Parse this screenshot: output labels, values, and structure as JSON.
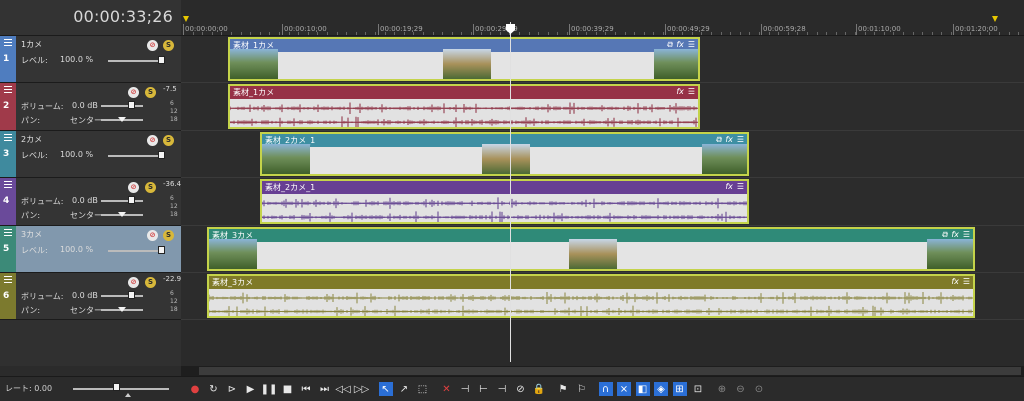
{
  "timecode": "00:00:33;26",
  "ruler": {
    "labels": [
      "00:00:00;00",
      "00:00:10;00",
      "00:00:19;29",
      "00:00:29;29",
      "00:00:39;29",
      "00:00:49;29",
      "00:00:59;28",
      "00:01:10;00",
      "00:01:20;00"
    ]
  },
  "tracks": [
    {
      "num": "1",
      "kind": "video",
      "name": "1カメ",
      "level_label": "レベル:",
      "level_value": "100.0 %",
      "level": 1.0,
      "color": "#4f7dbf",
      "event": {
        "name": "素材_1カメ",
        "bar_color": "#5677b5",
        "icons": [
          "crop",
          "fx",
          "menu"
        ]
      }
    },
    {
      "num": "2",
      "kind": "audio",
      "volume_label": "ボリューム:",
      "volume_value": "0.0 dB",
      "pan_label": "パン:",
      "pan_value": "センター",
      "peak": "-7.5",
      "scale": [
        "6",
        "12",
        "18"
      ],
      "color": "#a03a4a",
      "event": {
        "name": "素材_1カメ",
        "bar_color": "#963146",
        "icons": [
          "fx",
          "menu"
        ],
        "wave_color": "#8a2a3e"
      }
    },
    {
      "num": "3",
      "kind": "video",
      "name": "2カメ",
      "level_label": "レベル:",
      "level_value": "100.0 %",
      "level": 1.0,
      "color": "#3f8a9e",
      "event": {
        "name": "素材_2カメ_1",
        "bar_color": "#3e8fa3",
        "icons": [
          "crop",
          "fx",
          "menu"
        ]
      }
    },
    {
      "num": "4",
      "kind": "audio",
      "volume_label": "ボリューム:",
      "volume_value": "0.0 dB",
      "pan_label": "パン:",
      "pan_value": "センター",
      "peak": "-36.4",
      "scale": [
        "6",
        "12",
        "18"
      ],
      "color": "#6a4a9a",
      "event": {
        "name": "素材_2カメ_1",
        "bar_color": "#673f93",
        "icons": [
          "fx",
          "menu"
        ],
        "wave_color": "#5c3a8c"
      }
    },
    {
      "num": "5",
      "kind": "video",
      "name": "3カメ",
      "level_label": "レベル:",
      "level_value": "100.0 %",
      "level": 1.0,
      "color": "#3c8a78",
      "selected": true,
      "event": {
        "name": "素材_3カメ",
        "bar_color": "#2f8a78",
        "icons": [
          "crop",
          "fx",
          "menu"
        ]
      }
    },
    {
      "num": "6",
      "kind": "audio",
      "volume_label": "ボリューム:",
      "volume_value": "0.0 dB",
      "pan_label": "パン:",
      "pan_value": "センター",
      "peak": "-22.9",
      "scale": [
        "6",
        "12",
        "18"
      ],
      "color": "#7c7a2e",
      "event": {
        "name": "素材_3カメ",
        "bar_color": "#7f7a28",
        "icons": [
          "fx",
          "menu"
        ],
        "wave_color": "#8a8640"
      }
    }
  ],
  "footer": {
    "rate_label": "レート: 0.00",
    "toolbar": [
      {
        "icon": "record-icon",
        "glyph": "●",
        "style": "red"
      },
      {
        "icon": "loop-icon",
        "glyph": "↻"
      },
      {
        "icon": "play-from-start-icon",
        "glyph": "⊳"
      },
      {
        "icon": "play-icon",
        "glyph": "▶"
      },
      {
        "icon": "pause-icon",
        "glyph": "❚❚"
      },
      {
        "icon": "stop-icon",
        "glyph": "■"
      },
      {
        "icon": "go-to-start-icon",
        "glyph": "⏮"
      },
      {
        "icon": "go-to-end-icon",
        "glyph": "⏭"
      },
      {
        "icon": "prev-frame-icon",
        "glyph": "◁◁"
      },
      {
        "icon": "next-frame-icon",
        "glyph": "▷▷"
      },
      {
        "icon": "normal-edit-tool-icon",
        "glyph": "↖",
        "style": "on"
      },
      {
        "icon": "envelope-tool-icon",
        "glyph": "↗"
      },
      {
        "icon": "selection-tool-icon",
        "glyph": "⬚"
      },
      {
        "icon": "delete-icon",
        "glyph": "✕",
        "style": "red"
      },
      {
        "icon": "trim-icon",
        "glyph": "⊣"
      },
      {
        "icon": "trim-start-icon",
        "glyph": "⊢"
      },
      {
        "icon": "trim-end-icon",
        "glyph": "⊣"
      },
      {
        "icon": "split-icon",
        "glyph": "⊘"
      },
      {
        "icon": "lock-icon",
        "glyph": "🔒"
      },
      {
        "icon": "marker-icon",
        "glyph": "⚑"
      },
      {
        "icon": "region-icon",
        "glyph": "⚐"
      },
      {
        "icon": "snap-icon",
        "glyph": "∩",
        "style": "on"
      },
      {
        "icon": "auto-crossfade-icon",
        "glyph": "⨯",
        "style": "on"
      },
      {
        "icon": "auto-ripple-icon",
        "glyph": "◧",
        "style": "on"
      },
      {
        "icon": "lock-envelopes-icon",
        "glyph": "◈",
        "style": "on"
      },
      {
        "icon": "ignore-grouping-icon",
        "glyph": "⊞",
        "style": "on"
      },
      {
        "icon": "grouping-icon",
        "glyph": "⊡"
      },
      {
        "icon": "zoom-in-icon",
        "glyph": "⊕",
        "style": "dim"
      },
      {
        "icon": "zoom-out-icon",
        "glyph": "⊖",
        "style": "dim"
      },
      {
        "icon": "zoom-fit-icon",
        "glyph": "⊙",
        "style": "dim"
      }
    ]
  }
}
